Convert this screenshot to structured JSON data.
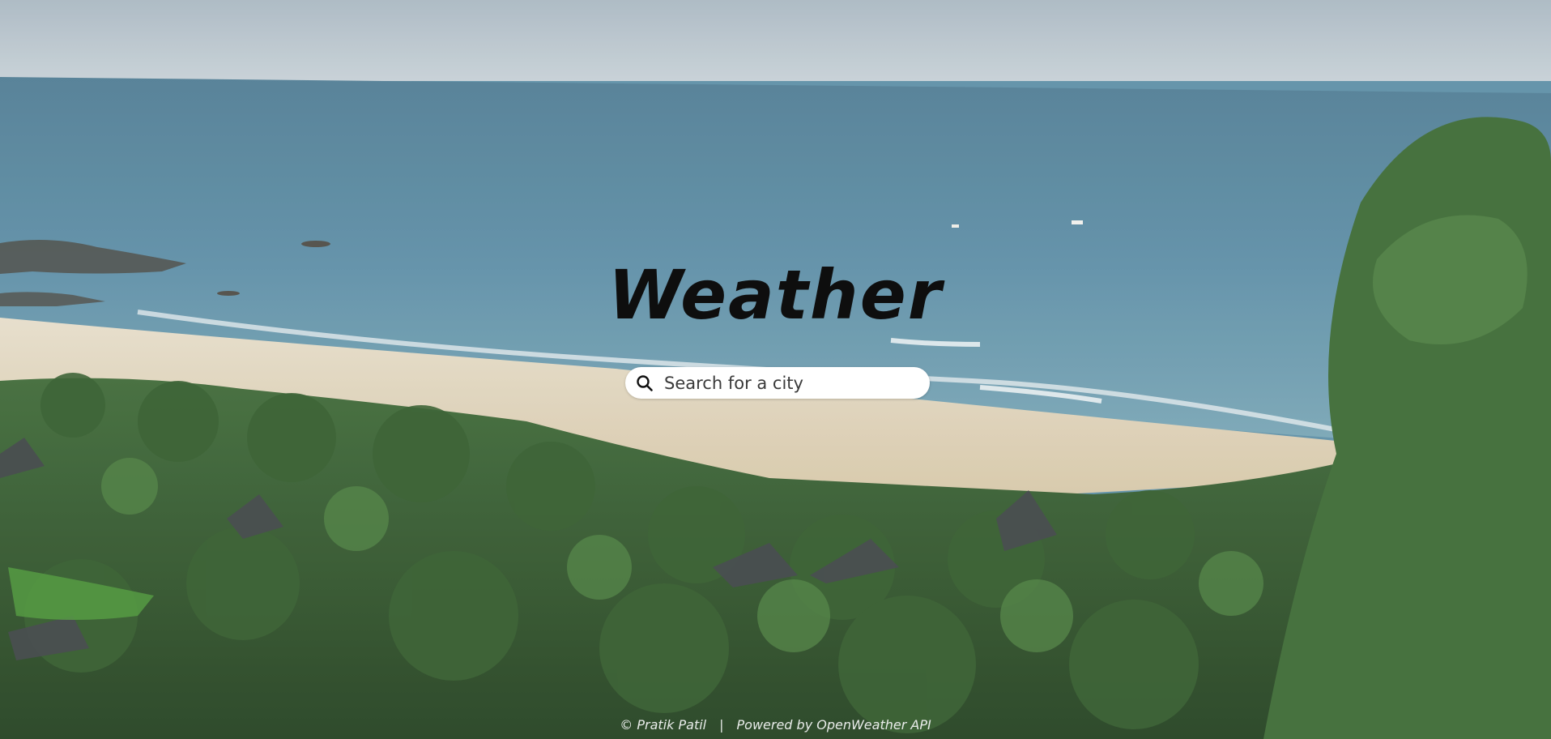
{
  "app": {
    "title": "Weather"
  },
  "search": {
    "placeholder": "Search for a city",
    "value": "",
    "icon": "search-icon"
  },
  "footer": {
    "credit": "© Pratik Patil",
    "separator": "|",
    "powered_by": "Powered by OpenWeather API"
  },
  "colors": {
    "title": "#0e0e0e",
    "search_background": "#ffffff",
    "footer_text": "#e9ecea"
  }
}
